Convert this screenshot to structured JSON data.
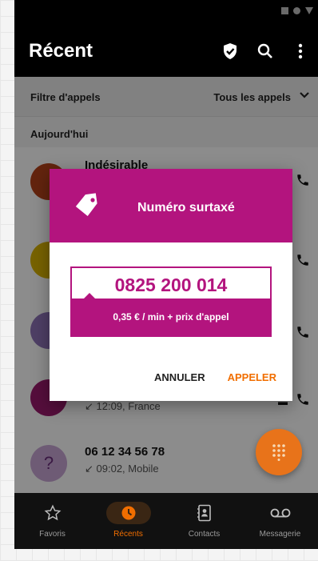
{
  "app": {
    "title": "Récent"
  },
  "filter": {
    "label": "Filtre d'appels",
    "value": "Tous les appels"
  },
  "section": {
    "today": "Aujourd'hui"
  },
  "calls": [
    {
      "name": "Indésirable",
      "meta": "",
      "avatar_color": "#b5431a",
      "avatar_glyph": ""
    },
    {
      "name": "",
      "meta": "",
      "avatar_color": "#d9b200",
      "avatar_glyph": ""
    },
    {
      "name": "",
      "meta": "",
      "avatar_color": "#8e74b8",
      "avatar_glyph": ""
    },
    {
      "name": "",
      "meta": "12:09, France",
      "avatar_color": "#9c1b6e",
      "avatar_glyph": ""
    },
    {
      "name": "06 12 34 56 78",
      "meta": "09:02, Mobile",
      "avatar_color": "#c9a7d6",
      "avatar_glyph": "?"
    }
  ],
  "dialog": {
    "title": "Numéro surtaxé",
    "number": "0825 200 014",
    "price": "0,35 € / min + prix d'appel",
    "cancel_label": "ANNULER",
    "call_label": "APPELER"
  },
  "nav": {
    "items": [
      {
        "label": "Favoris",
        "icon": "star-icon"
      },
      {
        "label": "Récents",
        "icon": "clock-icon"
      },
      {
        "label": "Contacts",
        "icon": "contacts-icon"
      },
      {
        "label": "Messagerie",
        "icon": "voicemail-icon"
      }
    ]
  },
  "colors": {
    "accent_magenta": "#b3147e",
    "accent_orange": "#f16e00",
    "appbar": "#000000"
  }
}
